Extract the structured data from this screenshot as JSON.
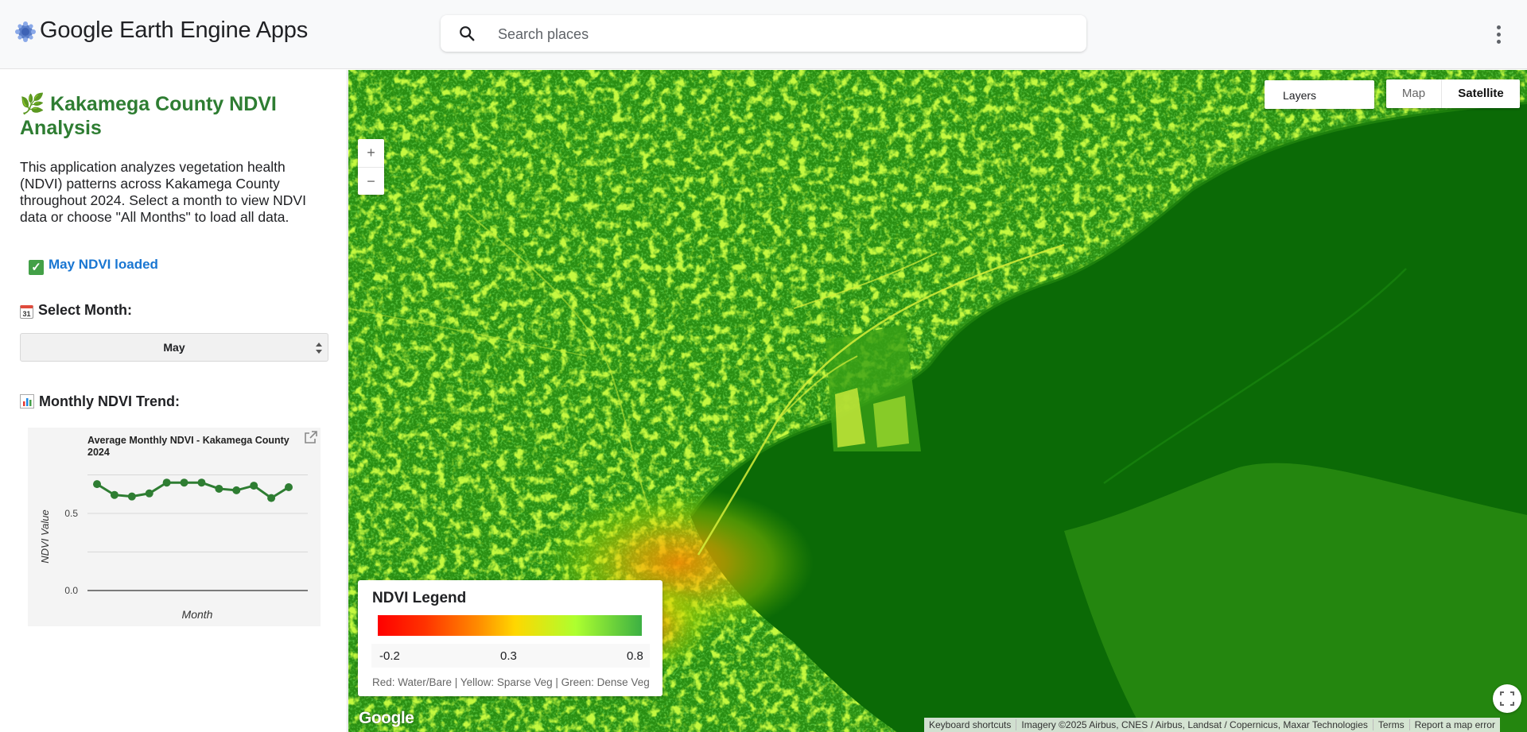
{
  "header": {
    "app_title": "Google Earth Engine Apps",
    "search_placeholder": "Search places",
    "logo_icon": "earth-engine-logo-icon",
    "menu_icon": "more-vert-icon"
  },
  "sidebar": {
    "title": "🌿 Kakamega County NDVI Analysis",
    "description": "This application analyzes vegetation health (NDVI) patterns across Kakamega County throughout 2024. Select a month to view NDVI data or choose \"All Months\" to load all data.",
    "status_text": "May NDVI loaded",
    "status_icon": "check-icon",
    "month_label": "Select Month:",
    "month_icon": "calendar-icon",
    "month_selected": "May",
    "trend_label": "Monthly NDVI Trend:",
    "trend_icon": "bar-chart-icon"
  },
  "chart_data": {
    "type": "line",
    "title": "Average Monthly NDVI - Kakamega County 2024",
    "title_line1": "Average Monthly NDVI - Kakamega County",
    "title_line2": "2024",
    "xlabel": "Month",
    "ylabel": "NDVI Value",
    "ylim": [
      0,
      0.8
    ],
    "yticks": [
      "0.0",
      "0.5"
    ],
    "ytick_values": [
      0,
      0.5
    ],
    "x": [
      1,
      2,
      3,
      4,
      5,
      6,
      7,
      8,
      9,
      10,
      11,
      12
    ],
    "series": [
      {
        "values": [
          0.69,
          0.62,
          0.61,
          0.63,
          0.7,
          0.7,
          0.7,
          0.66,
          0.65,
          0.68,
          0.6,
          0.67
        ]
      }
    ],
    "color": "#2e7d32",
    "grid": true
  },
  "map": {
    "layers_label": "Layers",
    "map_type_map": "Map",
    "map_type_satellite": "Satellite",
    "map_type_selected": "Satellite",
    "zoom_in": "+",
    "zoom_out": "−",
    "legend": {
      "title": "NDVI Legend",
      "min": "-0.2",
      "mid": "0.3",
      "max": "0.8",
      "note": "Red: Water/Bare | Yellow: Sparse Veg | Green: Dense Veg",
      "colors": [
        "#ff0000",
        "#ff8c00",
        "#ffd700",
        "#adff2f",
        "#3cb043"
      ]
    },
    "google_logo": "Google",
    "attribution": {
      "keyboard": "Keyboard shortcuts",
      "imagery": "Imagery ©2025 Airbus, CNES / Airbus, Landsat / Copernicus, Maxar Technologies",
      "terms": "Terms",
      "report": "Report a map error"
    }
  }
}
